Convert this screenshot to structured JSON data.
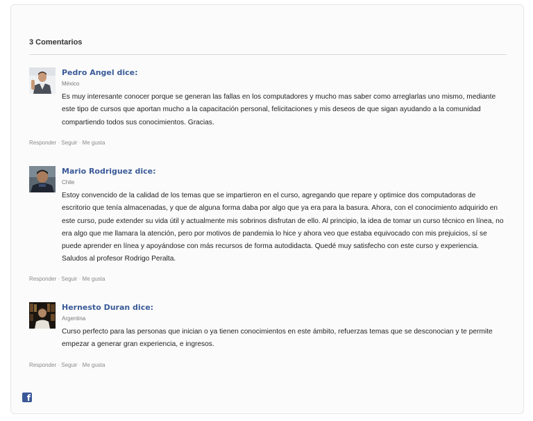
{
  "header": {
    "count_title": "3 Comentarios"
  },
  "actions": {
    "reply": "Responder",
    "follow": "Seguir",
    "like": "Me gusta",
    "separator": "·"
  },
  "comments": [
    {
      "author": "Pedro Angel dice:",
      "location": "México",
      "text": "Es muy interesante conocer porque se generan las fallas en los computadores y mucho mas saber como arreglarlas uno mismo, mediante este tipo de cursos que aportan mucho a la capacitación personal, felicitaciones y mis deseos de que sigan ayudando a la comunidad compartiendo todos sus conocimientos. Gracias."
    },
    {
      "author": "Mario Rodriguez dice:",
      "location": "Chile",
      "text": "Estoy convencido de la calidad de los temas que se impartieron en el curso, agregando que repare y optimice dos computadoras de escritorio que tenía almacenadas, y que de alguna forma daba por algo que ya era para la basura. Ahora, con el conocimiento adquirido en este curso, pude extender su vida útil y actualmente mis sobrinos disfrutan de ello. Al principio, la idea de tomar un curso técnico en línea, no era algo que me llamara la atención, pero por motivos de pandemia lo hice y ahora veo que estaba equivocado con mis prejuicios, sí se puede aprender en línea y apoyándose con más recursos de forma autodidacta. Quedé muy satisfecho con este curso y experiencia. Saludos al profesor Rodrigo Peralta."
    },
    {
      "author": "Hernesto Duran dice:",
      "location": "Argentina",
      "text": "Curso perfecto para las personas que inician o ya tienen conocimientos en este ámbito, refuerzas temas que se desconocian y te permite empezar a generar gran experiencia, e ingresos."
    }
  ],
  "footer": {
    "facebook_icon": "facebook-icon",
    "facebook_glyph": "f",
    "brand_color": "#3b5998"
  }
}
